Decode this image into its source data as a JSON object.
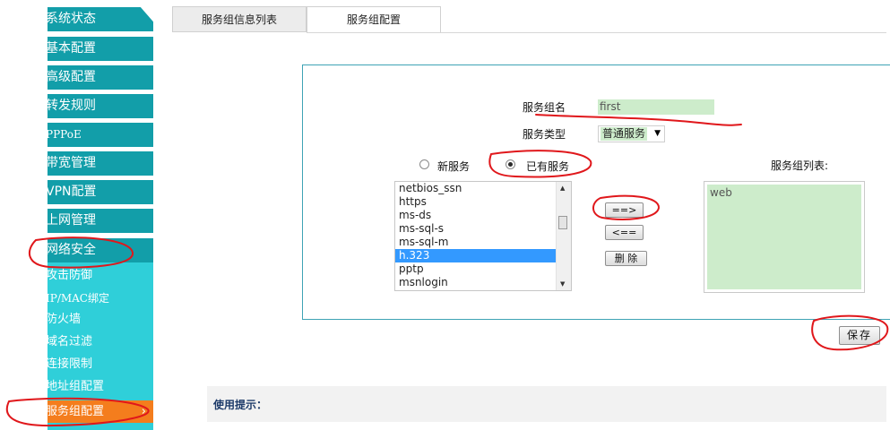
{
  "sidebar": {
    "items": [
      {
        "label": "系统状态"
      },
      {
        "label": "基本配置"
      },
      {
        "label": "高级配置"
      },
      {
        "label": "转发规则"
      },
      {
        "label": "PPPoE"
      },
      {
        "label": "带宽管理"
      },
      {
        "label": "VPN配置"
      },
      {
        "label": "上网管理"
      },
      {
        "label": "网络安全"
      }
    ],
    "subitems": [
      {
        "label": "攻击防御"
      },
      {
        "label": "IP/MAC绑定"
      },
      {
        "label": "防火墙"
      },
      {
        "label": "域名过滤"
      },
      {
        "label": "连接限制"
      },
      {
        "label": "地址组配置"
      },
      {
        "label": "服务组配置"
      }
    ]
  },
  "tabs": [
    {
      "label": "服务组信息列表"
    },
    {
      "label": "服务组配置"
    }
  ],
  "form": {
    "name_label": "服务组名",
    "name_value": "first",
    "type_label": "服务类型",
    "type_value": "普通服务",
    "radio_new": "新服务",
    "radio_existing": "已有服务",
    "selected_radio": "已有服务",
    "group_list_label": "服务组列表:",
    "available_services": [
      "netbios_ssn",
      "https",
      "ms-ds",
      "ms-sql-s",
      "ms-sql-m",
      "h.323",
      "pptp",
      "msnlogin"
    ],
    "selected_service": "h.323",
    "group_services": [
      "web"
    ],
    "add_button": "==>",
    "remove_button": "<==",
    "delete_button": "删 除",
    "save_button": "保存"
  },
  "tip": {
    "label": "使用提示："
  },
  "colors": {
    "sidebar_bg": "#129ea9",
    "submenu_bg": "#2fcfd9",
    "active_orange": "#f47d1d",
    "field_green": "#cdeccb",
    "panel_border": "#3ea3b5",
    "annotation_red": "#e0171b"
  }
}
